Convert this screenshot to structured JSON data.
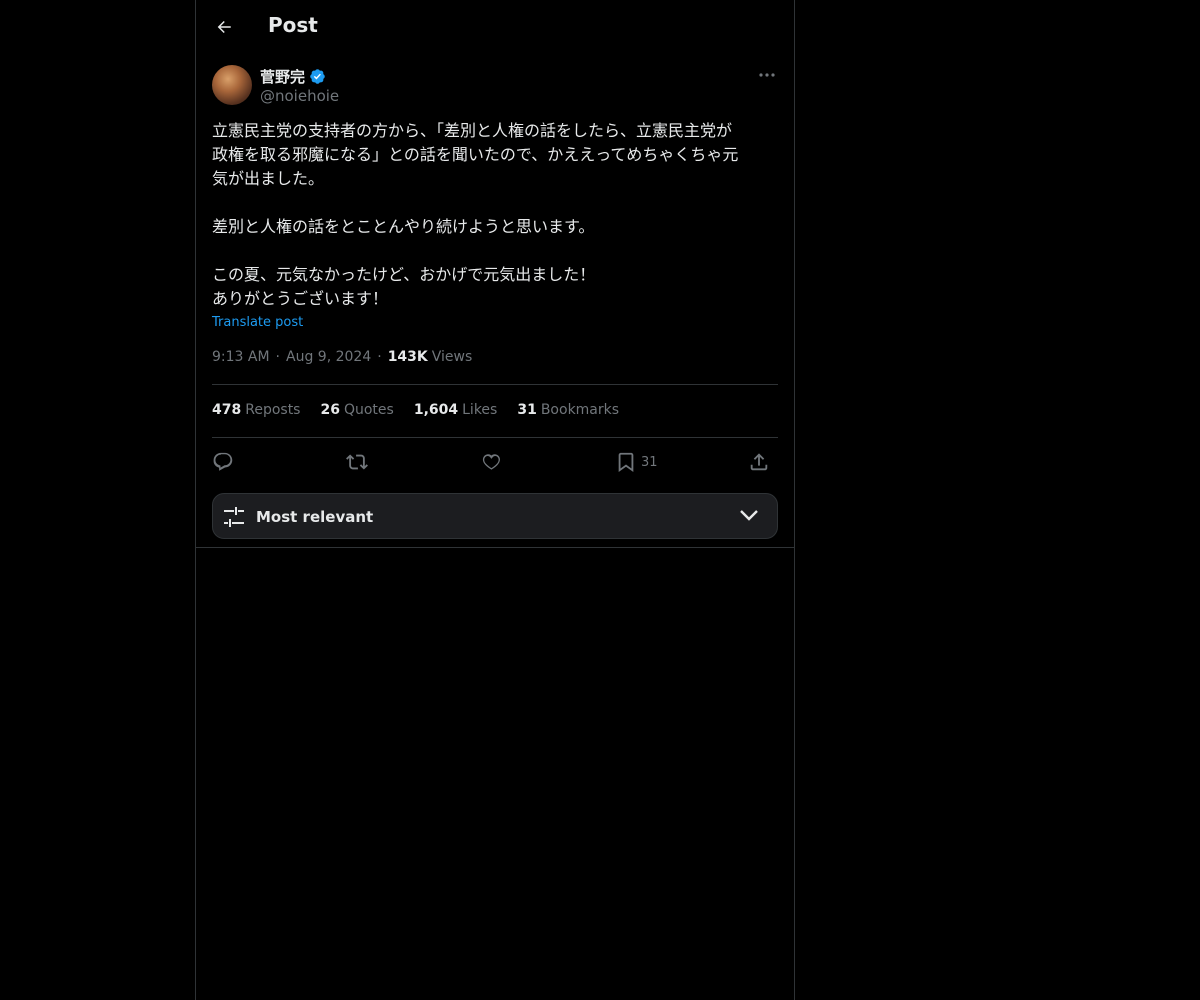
{
  "header": {
    "title": "Post"
  },
  "author": {
    "display_name": "菅野完",
    "handle": "@noiehoie",
    "verified": true
  },
  "post": {
    "paragraphs": [
      [
        "立憲民主党の支持者の方から、「差別と人権の話をしたら、立憲民主党が",
        "政権を取る邪魔になる」との話を聞いたので、かええってめちゃくちゃ元",
        "気が出ました。"
      ],
      [
        "差別と人権の話をとことんやり続けようと思います。"
      ],
      [
        "この夏、元気なかったけど、おかげで元気出ました！",
        "ありがとうございます！"
      ]
    ],
    "translate_label": "Translate post",
    "time": "9:13 AM",
    "date": "Aug 9, 2024",
    "views_count": "143K",
    "views_label": "Views"
  },
  "stats": {
    "reposts_count": "478",
    "reposts_label": "Reposts",
    "quotes_count": "26",
    "quotes_label": "Quotes",
    "likes_count": "1,604",
    "likes_label": "Likes",
    "bookmarks_count": "31",
    "bookmarks_label": "Bookmarks"
  },
  "actions": {
    "bookmark_count": "31"
  },
  "sort": {
    "label": "Most relevant"
  },
  "colors": {
    "background": "#000000",
    "text": "#e7e9ea",
    "muted": "#71767b",
    "accent": "#1d9bf0",
    "border": "#2f3336"
  },
  "icons": [
    "back-arrow-icon",
    "verified-badge-icon",
    "more-icon",
    "reply-icon",
    "repost-icon",
    "like-icon",
    "bookmark-icon",
    "share-icon",
    "sliders-icon",
    "chevron-down-icon"
  ]
}
